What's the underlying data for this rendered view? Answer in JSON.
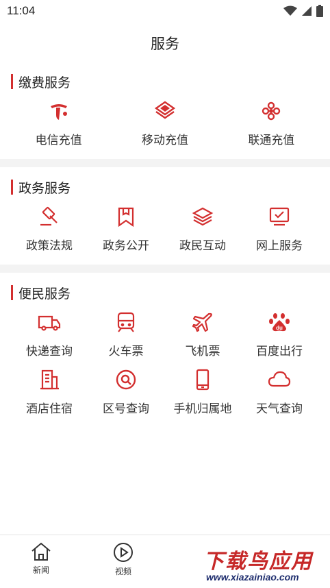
{
  "status_bar": {
    "time": "11:04"
  },
  "page": {
    "title": "服务"
  },
  "sections": {
    "payment": {
      "title": "缴费服务",
      "items": [
        {
          "label": "电信充值",
          "icon": "telecom-logo-icon"
        },
        {
          "label": "移动充值",
          "icon": "mobile-logo-icon"
        },
        {
          "label": "联通充值",
          "icon": "unicom-logo-icon"
        }
      ]
    },
    "government": {
      "title": "政务服务",
      "items": [
        {
          "label": "政策法规",
          "icon": "gavel-icon"
        },
        {
          "label": "政务公开",
          "icon": "bookmark-icon"
        },
        {
          "label": "政民互动",
          "icon": "layers-icon"
        },
        {
          "label": "网上服务",
          "icon": "monitor-check-icon"
        }
      ]
    },
    "convenience": {
      "title": "便民服务",
      "items": [
        {
          "label": "快递查询",
          "icon": "delivery-truck-icon"
        },
        {
          "label": "火车票",
          "icon": "train-icon"
        },
        {
          "label": "飞机票",
          "icon": "airplane-icon"
        },
        {
          "label": "百度出行",
          "icon": "baidu-paw-icon"
        },
        {
          "label": "酒店住宿",
          "icon": "hotel-building-icon"
        },
        {
          "label": "区号查询",
          "icon": "search-circle-icon"
        },
        {
          "label": "手机归属地",
          "icon": "phone-icon"
        },
        {
          "label": "天气查询",
          "icon": "cloud-icon"
        }
      ]
    }
  },
  "bottom_nav": {
    "tabs": [
      {
        "label": "新闻",
        "icon": "home-icon"
      },
      {
        "label": "视频",
        "icon": "play-circle-icon"
      }
    ]
  },
  "watermark": {
    "main": "下载鸟应用",
    "sub": "www.xiazainiao.com"
  },
  "colors": {
    "accent": "#d32f2f",
    "section_bar": "#d32f2f",
    "divider_band": "#f3f3f3"
  }
}
